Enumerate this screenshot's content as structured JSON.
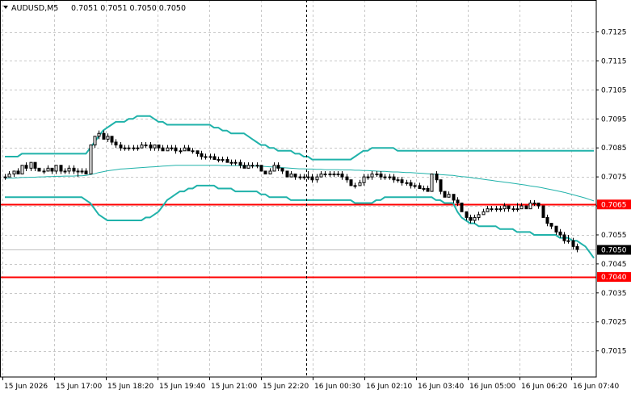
{
  "symbol": {
    "name": "AUDUSD,M5",
    "ohlc": "0.7051 0.7051 0.7050 0.7050"
  },
  "colors": {
    "background": "#ffffff",
    "grid": "#c8c8c8",
    "candle": "#000000",
    "bands": "#20b2aa",
    "level_line": "#ff0000",
    "price_tag_bg": "#000000",
    "level_tag_bg": "#ff0000"
  },
  "chart_data": {
    "type": "candlestick",
    "ylim": [
      0.7006,
      0.7136
    ],
    "y_ticks": [
      "0.7125",
      "0.7115",
      "0.7105",
      "0.7095",
      "0.7085",
      "0.7075",
      "0.7065",
      "0.7055",
      "0.7045",
      "0.7035",
      "0.7025",
      "0.7015"
    ],
    "x_labels": [
      "15 Jun 2026",
      "15 Jun 17:00",
      "15 Jun 18:20",
      "15 Jun 19:40",
      "15 Jun 21:00",
      "15 Jun 22:20",
      "16 Jun 00:30",
      "16 Jun 02:10",
      "16 Jun 03:40",
      "16 Jun 05:00",
      "16 Jun 06:20",
      "16 Jun 07:40"
    ],
    "grid": true,
    "current_price": "0.7050",
    "level_lines": [
      {
        "label": "0.7065",
        "value": 0.70655
      },
      {
        "label": "0.7040",
        "value": 0.70405
      }
    ],
    "candles": [
      [
        0.7075,
        0.7076,
        0.7074,
        0.7075
      ],
      [
        0.7075,
        0.7077,
        0.7075,
        0.7076
      ],
      [
        0.7076,
        0.7077,
        0.7075,
        0.7077
      ],
      [
        0.7077,
        0.7078,
        0.7076,
        0.7076
      ],
      [
        0.7076,
        0.7079,
        0.7076,
        0.7079
      ],
      [
        0.7079,
        0.708,
        0.7077,
        0.7078
      ],
      [
        0.7078,
        0.708,
        0.7077,
        0.708
      ],
      [
        0.708,
        0.708,
        0.7077,
        0.7078
      ],
      [
        0.7078,
        0.7078,
        0.7077,
        0.7077
      ],
      [
        0.7077,
        0.7078,
        0.7076,
        0.7077
      ],
      [
        0.7077,
        0.7079,
        0.7077,
        0.7078
      ],
      [
        0.7078,
        0.7078,
        0.7076,
        0.7077
      ],
      [
        0.7077,
        0.7079,
        0.7076,
        0.7079
      ],
      [
        0.7079,
        0.7079,
        0.7076,
        0.7077
      ],
      [
        0.7077,
        0.7078,
        0.7076,
        0.7077
      ],
      [
        0.7077,
        0.7079,
        0.7076,
        0.7078
      ],
      [
        0.7078,
        0.7079,
        0.7076,
        0.7077
      ],
      [
        0.7077,
        0.7078,
        0.7075,
        0.7077
      ],
      [
        0.7077,
        0.7078,
        0.7076,
        0.7077
      ],
      [
        0.7077,
        0.7078,
        0.7076,
        0.7076
      ],
      [
        0.7076,
        0.7086,
        0.7076,
        0.7086
      ],
      [
        0.7086,
        0.7089,
        0.7085,
        0.7089
      ],
      [
        0.7089,
        0.7091,
        0.7088,
        0.709
      ],
      [
        0.709,
        0.7091,
        0.7088,
        0.7088
      ],
      [
        0.7088,
        0.709,
        0.7087,
        0.7089
      ],
      [
        0.7089,
        0.7089,
        0.7086,
        0.7087
      ],
      [
        0.7087,
        0.7088,
        0.7085,
        0.7086
      ],
      [
        0.7086,
        0.7087,
        0.7084,
        0.7085
      ],
      [
        0.7085,
        0.7086,
        0.7084,
        0.7085
      ],
      [
        0.7085,
        0.7086,
        0.7084,
        0.7085
      ],
      [
        0.7085,
        0.7086,
        0.7084,
        0.7085
      ],
      [
        0.7085,
        0.7086,
        0.7084,
        0.7085
      ],
      [
        0.7085,
        0.7087,
        0.7085,
        0.7086
      ],
      [
        0.7086,
        0.7087,
        0.7085,
        0.7086
      ],
      [
        0.7086,
        0.7087,
        0.7084,
        0.7085
      ],
      [
        0.7085,
        0.7086,
        0.7084,
        0.7086
      ],
      [
        0.7086,
        0.7086,
        0.7084,
        0.7085
      ],
      [
        0.7085,
        0.7086,
        0.7084,
        0.7084
      ],
      [
        0.7084,
        0.7086,
        0.7084,
        0.7085
      ],
      [
        0.7085,
        0.7086,
        0.7084,
        0.7085
      ],
      [
        0.7085,
        0.7086,
        0.7083,
        0.7084
      ],
      [
        0.7084,
        0.7085,
        0.7083,
        0.7084
      ],
      [
        0.7084,
        0.7086,
        0.7084,
        0.7085
      ],
      [
        0.7085,
        0.7086,
        0.7084,
        0.7084
      ],
      [
        0.7084,
        0.7085,
        0.7083,
        0.7084
      ],
      [
        0.7084,
        0.7084,
        0.7082,
        0.7083
      ],
      [
        0.7083,
        0.7084,
        0.7081,
        0.7082
      ],
      [
        0.7082,
        0.7083,
        0.7081,
        0.7082
      ],
      [
        0.7082,
        0.7083,
        0.7081,
        0.7082
      ],
      [
        0.7082,
        0.7083,
        0.7081,
        0.7081
      ],
      [
        0.7081,
        0.7082,
        0.708,
        0.7081
      ],
      [
        0.7081,
        0.7082,
        0.708,
        0.7081
      ],
      [
        0.7081,
        0.7082,
        0.708,
        0.708
      ],
      [
        0.708,
        0.7081,
        0.7079,
        0.708
      ],
      [
        0.708,
        0.7081,
        0.7079,
        0.708
      ],
      [
        0.708,
        0.7081,
        0.7078,
        0.7079
      ],
      [
        0.7079,
        0.708,
        0.7078,
        0.7078
      ],
      [
        0.7078,
        0.708,
        0.7078,
        0.7079
      ],
      [
        0.7079,
        0.708,
        0.7078,
        0.7079
      ],
      [
        0.7079,
        0.708,
        0.7078,
        0.7079
      ],
      [
        0.7079,
        0.7079,
        0.7077,
        0.7077
      ],
      [
        0.7077,
        0.7077,
        0.7076,
        0.7076
      ],
      [
        0.7076,
        0.7078,
        0.7076,
        0.7077
      ],
      [
        0.7077,
        0.708,
        0.7077,
        0.7079
      ],
      [
        0.7079,
        0.708,
        0.7077,
        0.7078
      ],
      [
        0.7078,
        0.7078,
        0.7076,
        0.7077
      ],
      [
        0.7077,
        0.7077,
        0.7075,
        0.7075
      ],
      [
        0.7075,
        0.7077,
        0.7075,
        0.7076
      ],
      [
        0.7076,
        0.7076,
        0.7074,
        0.7075
      ],
      [
        0.7075,
        0.7076,
        0.7074,
        0.7075
      ],
      [
        0.7075,
        0.7076,
        0.7074,
        0.7075
      ],
      [
        0.7075,
        0.7077,
        0.7074,
        0.7075
      ],
      [
        0.7075,
        0.7076,
        0.7073,
        0.7074
      ],
      [
        0.7074,
        0.7076,
        0.7073,
        0.7075
      ],
      [
        0.7075,
        0.7077,
        0.7075,
        0.7076
      ],
      [
        0.7076,
        0.7077,
        0.7075,
        0.7076
      ],
      [
        0.7076,
        0.7077,
        0.7075,
        0.7076
      ],
      [
        0.7076,
        0.7077,
        0.7075,
        0.7076
      ],
      [
        0.7076,
        0.7077,
        0.7075,
        0.7076
      ],
      [
        0.7076,
        0.7077,
        0.7074,
        0.7075
      ],
      [
        0.7075,
        0.7076,
        0.7073,
        0.7074
      ],
      [
        0.7074,
        0.7074,
        0.7072,
        0.7072
      ],
      [
        0.7072,
        0.7073,
        0.7071,
        0.7072
      ],
      [
        0.7072,
        0.7074,
        0.7072,
        0.7073
      ],
      [
        0.7073,
        0.7076,
        0.7072,
        0.7075
      ],
      [
        0.7075,
        0.7076,
        0.7074,
        0.7075
      ],
      [
        0.7075,
        0.7077,
        0.7074,
        0.7076
      ],
      [
        0.7076,
        0.7077,
        0.7075,
        0.7076
      ],
      [
        0.7076,
        0.7077,
        0.7074,
        0.7075
      ],
      [
        0.7075,
        0.7076,
        0.7074,
        0.7075
      ],
      [
        0.7075,
        0.7076,
        0.7074,
        0.7075
      ],
      [
        0.7075,
        0.7076,
        0.7073,
        0.7074
      ],
      [
        0.7074,
        0.7075,
        0.7073,
        0.7074
      ],
      [
        0.7074,
        0.7075,
        0.7072,
        0.7073
      ],
      [
        0.7073,
        0.7074,
        0.7072,
        0.7073
      ],
      [
        0.7073,
        0.7074,
        0.7071,
        0.7072
      ],
      [
        0.7072,
        0.7073,
        0.7071,
        0.7072
      ],
      [
        0.7072,
        0.7073,
        0.7071,
        0.7071
      ],
      [
        0.7071,
        0.7072,
        0.707,
        0.7071
      ],
      [
        0.7071,
        0.7072,
        0.707,
        0.707
      ],
      [
        0.707,
        0.7076,
        0.707,
        0.7076
      ],
      [
        0.7076,
        0.7077,
        0.7073,
        0.7074
      ],
      [
        0.7074,
        0.7074,
        0.7069,
        0.707
      ],
      [
        0.707,
        0.707,
        0.7068,
        0.7068
      ],
      [
        0.7068,
        0.707,
        0.7068,
        0.7069
      ],
      [
        0.7069,
        0.7069,
        0.7066,
        0.7067
      ],
      [
        0.7067,
        0.7068,
        0.7065,
        0.7066
      ],
      [
        0.7066,
        0.7066,
        0.7063,
        0.7063
      ],
      [
        0.7063,
        0.7063,
        0.706,
        0.7061
      ],
      [
        0.7061,
        0.7062,
        0.7059,
        0.706
      ],
      [
        0.706,
        0.7062,
        0.7059,
        0.7061
      ],
      [
        0.7061,
        0.7063,
        0.706,
        0.7062
      ],
      [
        0.7062,
        0.7064,
        0.7062,
        0.7063
      ],
      [
        0.7063,
        0.7065,
        0.7063,
        0.7064
      ],
      [
        0.7064,
        0.7065,
        0.7063,
        0.7064
      ],
      [
        0.7064,
        0.7065,
        0.7063,
        0.7064
      ],
      [
        0.7064,
        0.7065,
        0.7063,
        0.7064
      ],
      [
        0.7064,
        0.7066,
        0.7063,
        0.7065
      ],
      [
        0.7065,
        0.7065,
        0.7063,
        0.7064
      ],
      [
        0.7064,
        0.7065,
        0.7063,
        0.7064
      ],
      [
        0.7064,
        0.7066,
        0.7063,
        0.7064
      ],
      [
        0.7064,
        0.7066,
        0.7064,
        0.7065
      ],
      [
        0.7065,
        0.7065,
        0.7064,
        0.7064
      ],
      [
        0.7064,
        0.7067,
        0.7064,
        0.7066
      ],
      [
        0.7066,
        0.7067,
        0.7065,
        0.7066
      ],
      [
        0.7066,
        0.7066,
        0.7064,
        0.7065
      ],
      [
        0.7065,
        0.7065,
        0.7061,
        0.7061
      ],
      [
        0.7061,
        0.7062,
        0.7058,
        0.7059
      ],
      [
        0.7059,
        0.7059,
        0.7057,
        0.7058
      ],
      [
        0.7058,
        0.7058,
        0.7055,
        0.7056
      ],
      [
        0.7056,
        0.7057,
        0.7054,
        0.7055
      ],
      [
        0.7055,
        0.7056,
        0.7052,
        0.7053
      ],
      [
        0.7053,
        0.7055,
        0.7052,
        0.7053
      ],
      [
        0.7053,
        0.7054,
        0.705,
        0.7051
      ],
      [
        0.7051,
        0.7052,
        0.7049,
        0.705
      ]
    ],
    "bb_upper": [
      0.7082,
      0.7082,
      0.7082,
      0.7082,
      0.7083,
      0.7083,
      0.7083,
      0.7083,
      0.7083,
      0.7083,
      0.7083,
      0.7083,
      0.7083,
      0.7083,
      0.7083,
      0.7083,
      0.7083,
      0.7083,
      0.7083,
      0.7083,
      0.7085,
      0.7087,
      0.7089,
      0.7091,
      0.7092,
      0.7093,
      0.7094,
      0.7094,
      0.7094,
      0.7095,
      0.7095,
      0.7096,
      0.7096,
      0.7096,
      0.7096,
      0.7095,
      0.7094,
      0.7094,
      0.7093,
      0.7093,
      0.7093,
      0.7093,
      0.7093,
      0.7093,
      0.7093,
      0.7093,
      0.7093,
      0.7093,
      0.7093,
      0.7092,
      0.7092,
      0.7091,
      0.7091,
      0.709,
      0.709,
      0.709,
      0.709,
      0.7089,
      0.7088,
      0.7087,
      0.7086,
      0.7086,
      0.7085,
      0.7085,
      0.7084,
      0.7084,
      0.7084,
      0.7084,
      0.7083,
      0.7083,
      0.7082,
      0.7082,
      0.7081,
      0.7081,
      0.7081,
      0.7081,
      0.7081,
      0.7081,
      0.7081,
      0.7081,
      0.7081,
      0.7081,
      0.7082,
      0.7083,
      0.7084,
      0.7084,
      0.7085,
      0.7085,
      0.7085,
      0.7085,
      0.7085,
      0.7085,
      0.7084,
      0.7084,
      0.7084,
      0.7084,
      0.7084,
      0.7084,
      0.7084,
      0.7084,
      0.7084,
      0.7084,
      0.7084,
      0.7084,
      0.7084,
      0.7084,
      0.7084,
      0.7084,
      0.7084,
      0.7084,
      0.7084,
      0.7084,
      0.7084,
      0.7084,
      0.7084,
      0.7084,
      0.7084,
      0.7084,
      0.7084,
      0.7084,
      0.7084,
      0.7084,
      0.7084,
      0.7084,
      0.7084,
      0.7084,
      0.7084,
      0.7084,
      0.7084,
      0.7084,
      0.7084,
      0.7084,
      0.7084,
      0.7084,
      0.7084,
      0.7084,
      0.7084,
      0.7084,
      0.7084
    ],
    "bb_middle": [
      0.70745,
      0.70746,
      0.70746,
      0.70747,
      0.70748,
      0.70748,
      0.70749,
      0.70749,
      0.7075,
      0.7075,
      0.70751,
      0.70751,
      0.70752,
      0.70752,
      0.70753,
      0.70753,
      0.70753,
      0.70754,
      0.70754,
      0.70755,
      0.70758,
      0.70761,
      0.70765,
      0.70768,
      0.70771,
      0.70773,
      0.70775,
      0.70777,
      0.70778,
      0.70779,
      0.7078,
      0.70781,
      0.70782,
      0.70783,
      0.70784,
      0.70785,
      0.70786,
      0.70787,
      0.70788,
      0.70789,
      0.7079,
      0.7079,
      0.7079,
      0.7079,
      0.7079,
      0.7079,
      0.7079,
      0.7079,
      0.7079,
      0.7079,
      0.7079,
      0.70789,
      0.70789,
      0.70789,
      0.70789,
      0.70789,
      0.70788,
      0.70788,
      0.70788,
      0.70787,
      0.70787,
      0.70786,
      0.70785,
      0.70784,
      0.70783,
      0.70782,
      0.70781,
      0.7078,
      0.70779,
      0.70778,
      0.70778,
      0.70777,
      0.70777,
      0.70776,
      0.70776,
      0.70775,
      0.70775,
      0.70775,
      0.70775,
      0.70774,
      0.70774,
      0.70774,
      0.70773,
      0.70773,
      0.70772,
      0.70772,
      0.70771,
      0.7077,
      0.70769,
      0.70769,
      0.70768,
      0.70767,
      0.70767,
      0.70766,
      0.70765,
      0.70765,
      0.70764,
      0.70763,
      0.70762,
      0.70761,
      0.7076,
      0.70759,
      0.70758,
      0.70757,
      0.70756,
      0.70755,
      0.70753,
      0.70751,
      0.7075,
      0.70748,
      0.70746,
      0.70744,
      0.70742,
      0.7074,
      0.70738,
      0.70736,
      0.70734,
      0.70732,
      0.7073,
      0.70728,
      0.70726,
      0.70724,
      0.70722,
      0.70719,
      0.70717,
      0.70715,
      0.70712,
      0.70709,
      0.70706,
      0.70703,
      0.707,
      0.70697,
      0.70693,
      0.70689,
      0.70685,
      0.70681,
      0.70677,
      0.70672,
      0.70667
    ],
    "bb_lower": [
      0.7068,
      0.7068,
      0.7068,
      0.7068,
      0.7068,
      0.7068,
      0.7068,
      0.7068,
      0.7068,
      0.7068,
      0.7068,
      0.7068,
      0.7068,
      0.7068,
      0.7068,
      0.7068,
      0.7068,
      0.7068,
      0.7068,
      0.7067,
      0.7066,
      0.7064,
      0.7062,
      0.7061,
      0.706,
      0.706,
      0.706,
      0.706,
      0.706,
      0.706,
      0.706,
      0.706,
      0.706,
      0.7061,
      0.7061,
      0.7062,
      0.7063,
      0.7065,
      0.7067,
      0.7068,
      0.7069,
      0.707,
      0.707,
      0.7071,
      0.7071,
      0.7072,
      0.7072,
      0.7072,
      0.7072,
      0.7072,
      0.7071,
      0.7071,
      0.7071,
      0.7071,
      0.707,
      0.707,
      0.707,
      0.707,
      0.707,
      0.707,
      0.7069,
      0.7069,
      0.7068,
      0.7068,
      0.7068,
      0.7068,
      0.7068,
      0.7067,
      0.7067,
      0.7067,
      0.7067,
      0.7067,
      0.7067,
      0.7067,
      0.7067,
      0.7067,
      0.7067,
      0.7067,
      0.7067,
      0.7067,
      0.7067,
      0.7067,
      0.7066,
      0.7066,
      0.7066,
      0.7066,
      0.7066,
      0.7067,
      0.7067,
      0.7068,
      0.7068,
      0.7068,
      0.7068,
      0.7068,
      0.7068,
      0.7068,
      0.7068,
      0.7068,
      0.7068,
      0.7068,
      0.7068,
      0.7067,
      0.7067,
      0.7066,
      0.7066,
      0.7066,
      0.7063,
      0.7061,
      0.706,
      0.7059,
      0.7059,
      0.7058,
      0.7058,
      0.7058,
      0.7058,
      0.7058,
      0.7057,
      0.7057,
      0.7057,
      0.7057,
      0.7056,
      0.7056,
      0.7056,
      0.7056,
      0.7055,
      0.7055,
      0.7055,
      0.7055,
      0.7055,
      0.7055,
      0.7054,
      0.7054,
      0.7054,
      0.7053,
      0.7053,
      0.7052,
      0.7051,
      0.7049,
      0.7047
    ]
  }
}
